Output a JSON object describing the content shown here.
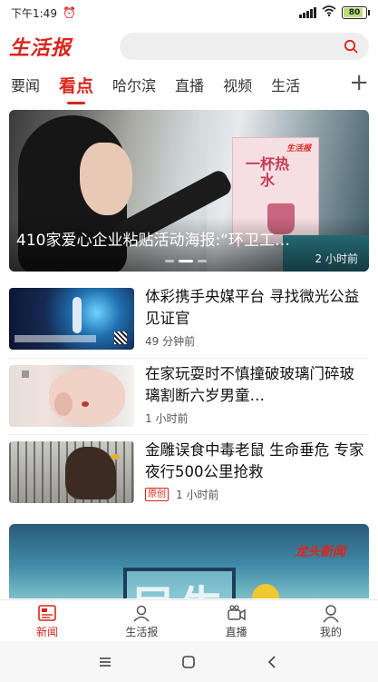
{
  "status_bar": {
    "time": "下午1:49",
    "battery_text": "80",
    "battery_level": 0.8,
    "icons": [
      "alarm-icon",
      "signal-icon",
      "wifi-icon",
      "battery-icon"
    ]
  },
  "header": {
    "logo_text": "生活报",
    "search_placeholder": "",
    "search_icon": "search-icon"
  },
  "tabs": {
    "items": [
      {
        "label": "要闻",
        "active": false
      },
      {
        "label": "看点",
        "active": true
      },
      {
        "label": "哈尔滨",
        "active": false
      },
      {
        "label": "直播",
        "active": false
      },
      {
        "label": "视频",
        "active": false
      },
      {
        "label": "生活",
        "active": false
      }
    ],
    "add_label": "+"
  },
  "hero": {
    "caption": "410家爱心企业粘贴活动海报:“环卫工…",
    "time": "2 小时前",
    "poster_title": "一杯热水",
    "poster_brand": "生活报",
    "slide_count": 3,
    "active_slide": 1
  },
  "news": [
    {
      "title": "体彩携手央媒平台 寻找微光公益见证官",
      "time": "49 分钟前",
      "badge": ""
    },
    {
      "title": "在家玩耍时不慎撞破玻璃门碎玻璃割断六岁男童…",
      "time": "1 小时前",
      "badge": ""
    },
    {
      "title": "金雕误食中毒老鼠 生命垂危 专家夜行500公里抢救",
      "time": "1 小时前",
      "badge": "原创"
    }
  ],
  "ad_card": {
    "big_text": "民生",
    "brand": "龙头新闻"
  },
  "bottom_nav": {
    "items": [
      {
        "label": "新闻",
        "icon": "news-icon",
        "active": true
      },
      {
        "label": "生活报",
        "icon": "life-report-icon",
        "active": false
      },
      {
        "label": "直播",
        "icon": "live-icon",
        "active": false
      },
      {
        "label": "我的",
        "icon": "profile-icon",
        "active": false
      }
    ]
  },
  "system_nav": [
    "menu-icon",
    "home-icon",
    "back-icon"
  ],
  "colors": {
    "accent": "#d9261c",
    "search_bg": "#eeeeee"
  }
}
